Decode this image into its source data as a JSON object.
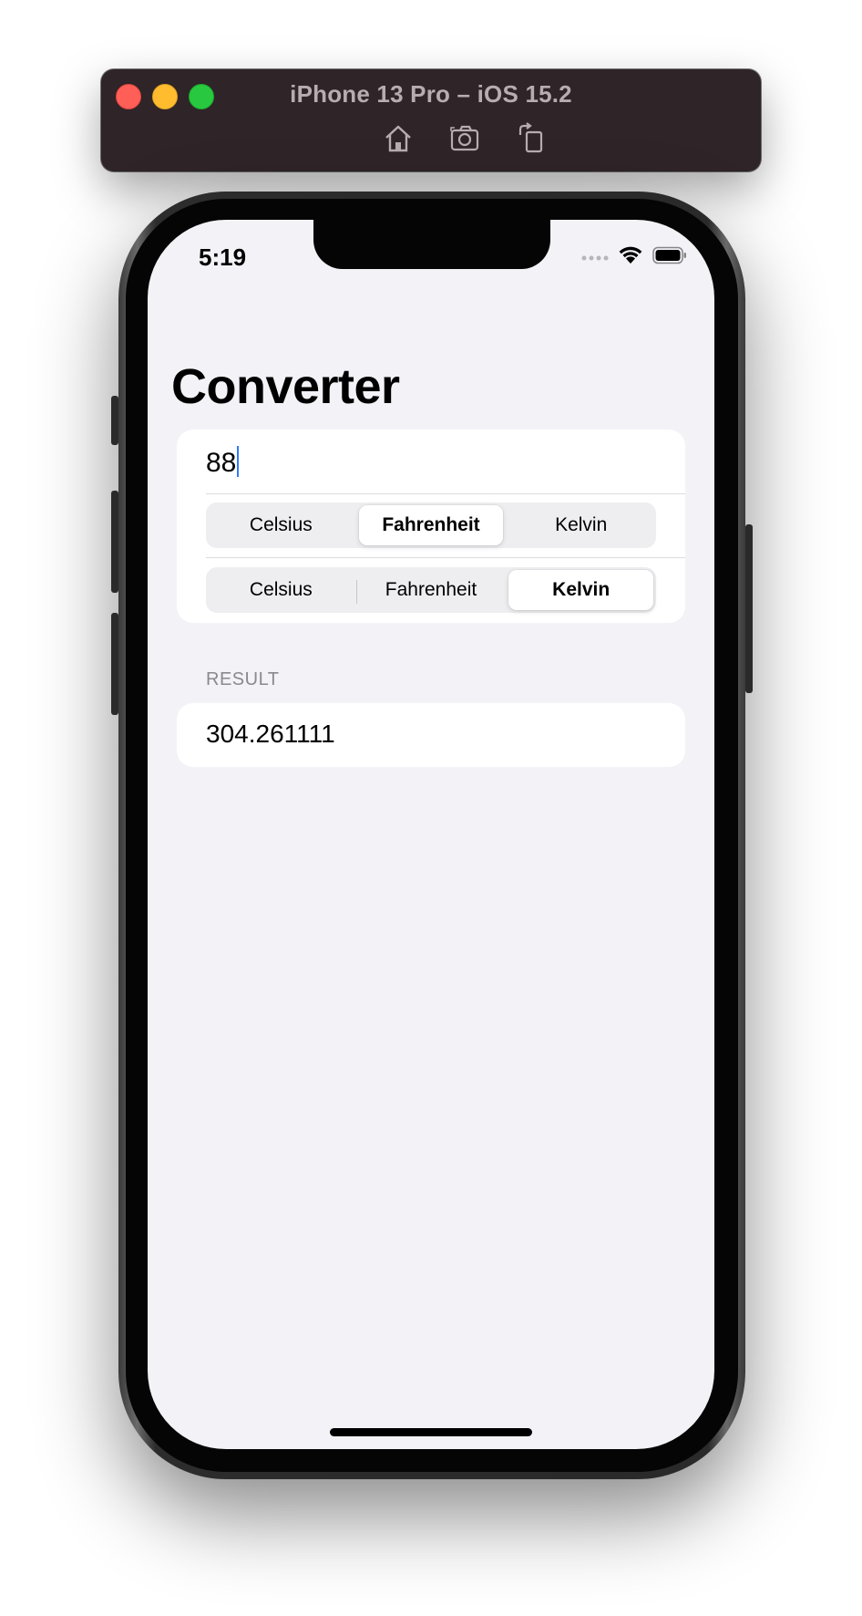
{
  "window": {
    "title": "iPhone 13 Pro – iOS 15.2",
    "toolbar_icons": [
      "home-icon",
      "screenshot-icon",
      "rotate-icon"
    ]
  },
  "status_bar": {
    "time": "5:19",
    "icons": [
      "cellular-dots-icon",
      "wifi-icon",
      "battery-icon"
    ]
  },
  "nav": {
    "title": "Converter"
  },
  "form": {
    "input_value": "88",
    "input_units": {
      "options": [
        "Celsius",
        "Fahrenheit",
        "Kelvin"
      ],
      "selected": "Fahrenheit"
    },
    "output_units": {
      "options": [
        "Celsius",
        "Fahrenheit",
        "Kelvin"
      ],
      "selected": "Kelvin"
    }
  },
  "result_section": {
    "header": "RESULT",
    "value": "304.261111"
  },
  "colors": {
    "titlebar": "#2f2428",
    "screen_background": "#f2f2f7",
    "caret": "#2f7bf6"
  }
}
